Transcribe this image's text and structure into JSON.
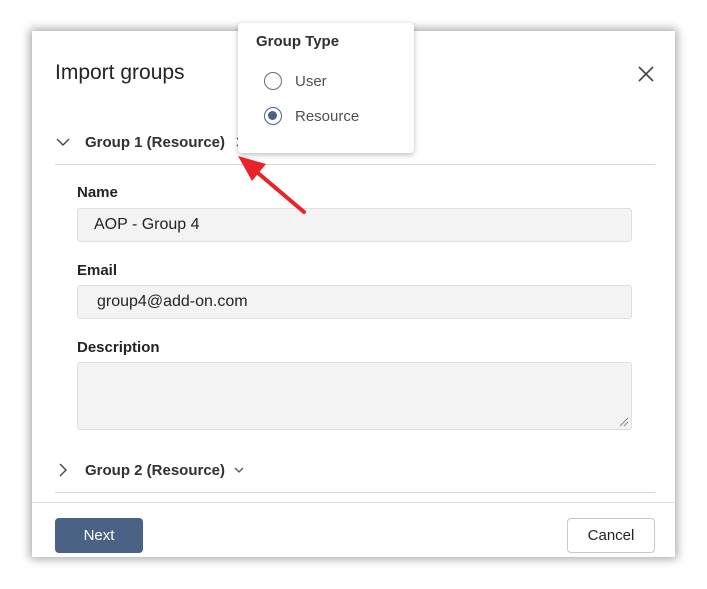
{
  "dialog": {
    "title": "Import groups",
    "close_icon": "close-icon"
  },
  "group1": {
    "header": "Group 1 (Resource)",
    "expanded": true,
    "fields": {
      "name_label": "Name",
      "name_value": "AOP - Group 4",
      "email_label": "Email",
      "email_value": "group4@add-on.com",
      "description_label": "Description",
      "description_value": ""
    }
  },
  "group2": {
    "header": "Group 2 (Resource)",
    "expanded": false
  },
  "popup": {
    "title": "Group Type",
    "options": [
      {
        "label": "User",
        "selected": false
      },
      {
        "label": "Resource",
        "selected": true
      }
    ]
  },
  "footer": {
    "next_label": "Next",
    "cancel_label": "Cancel"
  },
  "colors": {
    "primary_button": "#4a6284",
    "annotation_arrow": "#e8232a"
  }
}
